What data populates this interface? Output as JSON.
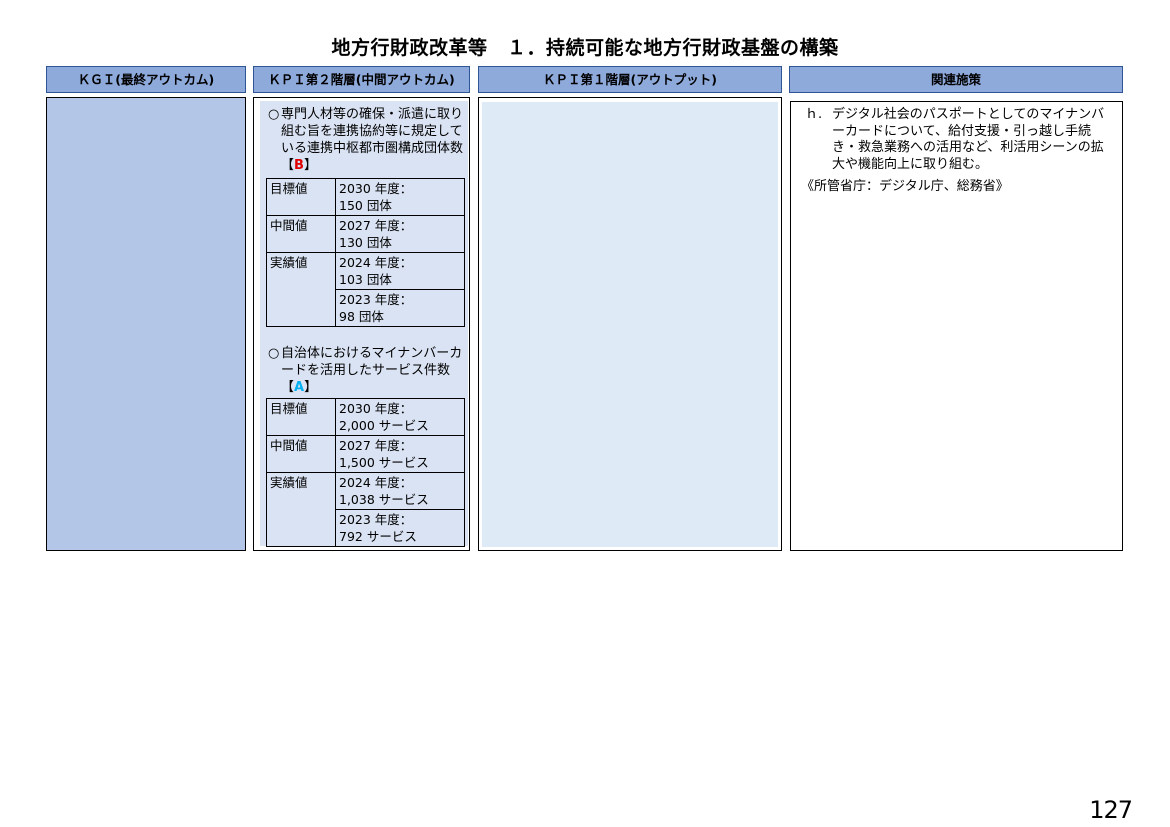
{
  "title": "地方行財政改革等　１．持続可能な地方行財政基盤の構築",
  "headers": {
    "kgi": "ＫＧＩ(最終アウトカム)",
    "kpi2": "ＫＰＩ第２階層(中間アウトカム)",
    "kpi1": "ＫＰＩ第１階層(アウトプット)",
    "policy": "関連施策"
  },
  "kpi2": {
    "items": [
      {
        "bullet": "○",
        "text": "専門人材等の確保・派遣に取り組む旨を連携協約等に規定している連携中枢都市圏構成団体数",
        "tag_open": "【",
        "tag": "B",
        "tag_close": "】",
        "rows": [
          {
            "label": "目標値",
            "value": "2030 年度：\n150 団体"
          },
          {
            "label": "中間値",
            "value": "2027 年度：\n130 団体"
          },
          {
            "label": "実績値",
            "value": "2024 年度：\n103 団体"
          },
          {
            "label": "",
            "value": "2023 年度：\n98 団体"
          }
        ]
      },
      {
        "bullet": "○",
        "text": "自治体におけるマイナンバーカードを活用したサービス件数",
        "tag_open": "【",
        "tag": "A",
        "tag_close": "】",
        "rows": [
          {
            "label": "目標値",
            "value": "2030 年度：\n2,000 サービス"
          },
          {
            "label": "中間値",
            "value": "2027 年度：\n1,500 サービス"
          },
          {
            "label": "実績値",
            "value": "2024 年度：\n1,038 サービス"
          },
          {
            "label": "",
            "value": "2023 年度：\n792 サービス"
          }
        ]
      }
    ]
  },
  "policy": {
    "mark": "ｈ.",
    "text": "デジタル社会のパスポートとしてのマイナンバーカードについて、給付支援・引っ越し手続き・救急業務への活用など、利活用シーンの拡大や機能向上に取り組む。",
    "agency": "《所管省庁：デジタル庁、総務省》"
  },
  "page_number": "127"
}
